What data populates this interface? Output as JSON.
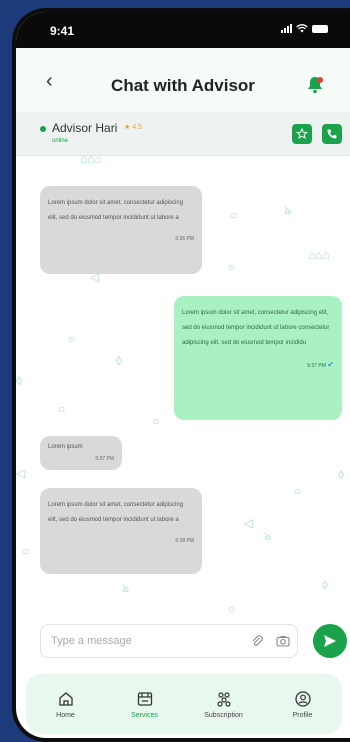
{
  "status_bar": {
    "time": "9:41"
  },
  "header": {
    "back_icon": "chevron-left-icon",
    "title": "Chat with Advisor",
    "bell_icon": "notification-bell-icon"
  },
  "advisor": {
    "name": "Advisor Hari",
    "rating": "4.5",
    "status": "online",
    "actions": [
      {
        "icon": "star-icon"
      },
      {
        "icon": "phone-icon"
      }
    ]
  },
  "messages": [
    {
      "direction": "in",
      "text": "Lorem ipsum dolor sit amet, consectetur adipiscing elit, sed do eiusmod tempor incididunt ut labore a",
      "time": "5:36 PM"
    },
    {
      "direction": "out",
      "text": "Lorem ipsum dolor sit amet, consectetur adipiscing elit, sed do eiusmod tempor incididunt ut labore consectetur adipiscing elit, sed do eiusmod tempor incididu",
      "time": "5:37 PM",
      "read": true
    },
    {
      "direction": "in",
      "text": "Lorem ipsum",
      "time": "5:37 PM"
    },
    {
      "direction": "in",
      "text": "Lorem ipsum dolor sit amet, consectetur adipiscing elit, sed do eiusmod tempor incididunt ut labore a",
      "time": "5:38 PM"
    }
  ],
  "composer": {
    "placeholder": "Type a message",
    "attach_icon": "paperclip-icon",
    "camera_icon": "camera-icon",
    "send_icon": "send-icon"
  },
  "tabs": [
    {
      "label": "Home",
      "icon": "home-icon",
      "active": false
    },
    {
      "label": "Services",
      "icon": "services-icon",
      "active": true
    },
    {
      "label": "Subscription",
      "icon": "subscription-icon",
      "active": false
    },
    {
      "label": "Profile",
      "icon": "profile-icon",
      "active": false
    }
  ],
  "colors": {
    "accent": "#1aa34a",
    "outgoing_bubble": "#a9f0c2",
    "incoming_bubble": "#d9d9d9",
    "background": "#1d3a7a"
  }
}
